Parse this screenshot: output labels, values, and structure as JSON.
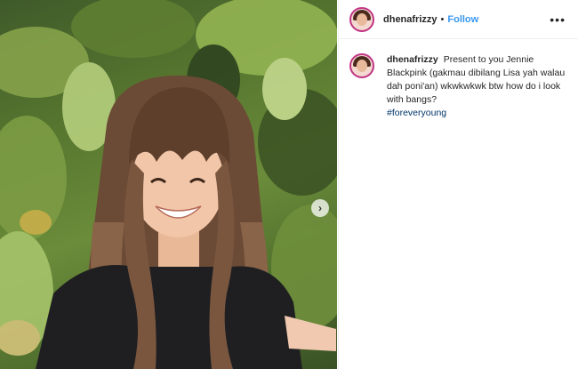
{
  "post": {
    "username": "dhenafrizzy",
    "separator": "•",
    "follow_label": "Follow",
    "more_icon": "•••",
    "next_icon": "›"
  },
  "caption": {
    "username": "dhenafrizzy",
    "text": "Present to you Jennie Blackpink (gakmau dibilang Lisa yah walau dah poni'an) wkwkwkwk btw how do i look with bangs?",
    "hashtag": "#foreveryoung"
  },
  "colors": {
    "accent": "#3897f0",
    "hashtag": "#003569",
    "avatar_ring": "#c13584"
  }
}
